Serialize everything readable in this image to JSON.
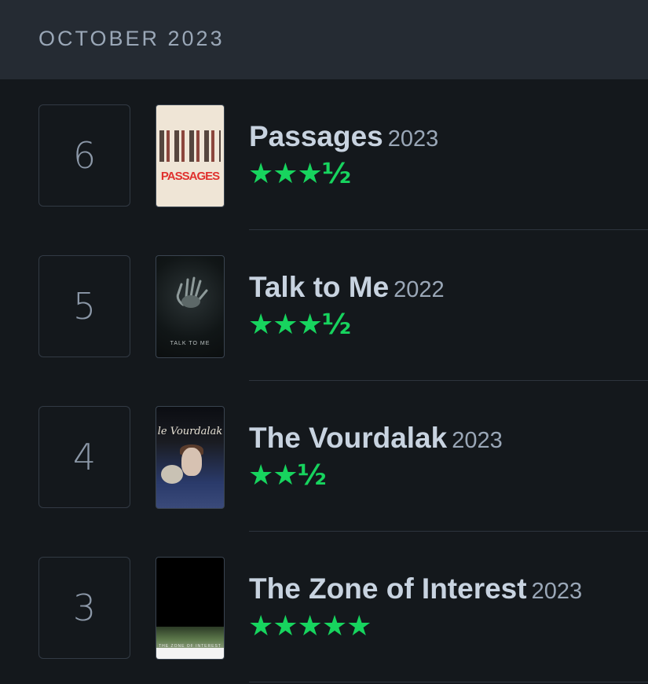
{
  "month_header": "OCTOBER 2023",
  "colors": {
    "background": "#14181c",
    "header_bg": "#252b33",
    "title": "#c8d3e0",
    "muted": "#9aa7b7",
    "star": "#17d45e"
  },
  "entries": [
    {
      "rank": "6",
      "title": "Passages",
      "year": "2023",
      "rating": "★★★½",
      "rating_value": 3.5,
      "poster_text": "PASSAGES"
    },
    {
      "rank": "5",
      "title": "Talk to Me",
      "year": "2022",
      "rating": "★★★½",
      "rating_value": 3.5,
      "poster_text": "TALK TO ME"
    },
    {
      "rank": "4",
      "title": "The Vourdalak",
      "year": "2023",
      "rating": "★★½",
      "rating_value": 2.5,
      "poster_text": "le Vourdalak"
    },
    {
      "rank": "3",
      "title": "The Zone of Interest",
      "year": "2023",
      "rating": "★★★★★",
      "rating_value": 5,
      "poster_text": "THE ZONE OF INTEREST"
    }
  ]
}
